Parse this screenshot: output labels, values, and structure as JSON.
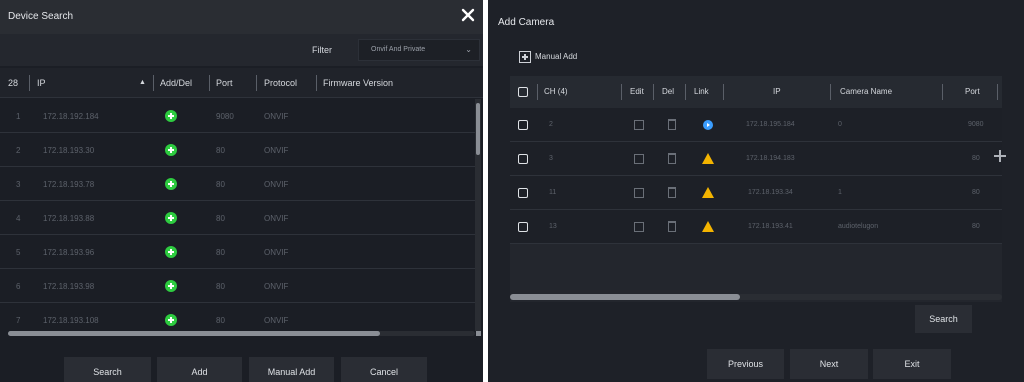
{
  "device_search": {
    "title": "Device Search",
    "filter_label": "Filter",
    "filter_value": "Onvif And Private",
    "count": "28",
    "columns": {
      "ip": "IP",
      "add_del": "Add/Del",
      "port": "Port",
      "protocol": "Protocol",
      "firmware": "Firmware Version"
    },
    "rows": [
      {
        "no": "1",
        "ip": "172.18.192.184",
        "port": "9080",
        "protocol": "ONVIF",
        "firmware": ""
      },
      {
        "no": "2",
        "ip": "172.18.193.30",
        "port": "80",
        "protocol": "ONVIF",
        "firmware": ""
      },
      {
        "no": "3",
        "ip": "172.18.193.78",
        "port": "80",
        "protocol": "ONVIF",
        "firmware": ""
      },
      {
        "no": "4",
        "ip": "172.18.193.88",
        "port": "80",
        "protocol": "ONVIF",
        "firmware": ""
      },
      {
        "no": "5",
        "ip": "172.18.193.96",
        "port": "80",
        "protocol": "ONVIF",
        "firmware": ""
      },
      {
        "no": "6",
        "ip": "172.18.193.98",
        "port": "80",
        "protocol": "ONVIF",
        "firmware": ""
      },
      {
        "no": "7",
        "ip": "172.18.193.108",
        "port": "80",
        "protocol": "ONVIF",
        "firmware": ""
      }
    ],
    "buttons": {
      "search": "Search",
      "add": "Add",
      "manual_add": "Manual Add",
      "cancel": "Cancel"
    }
  },
  "add_camera": {
    "title": "Add Camera",
    "manual_add": "Manual Add",
    "columns": {
      "ch": "CH (4)",
      "edit": "Edit",
      "del": "Del",
      "link": "Link",
      "ip": "IP",
      "camera_name": "Camera Name",
      "port": "Port"
    },
    "rows": [
      {
        "ch": "2",
        "link": "connected",
        "ip": "172.18.195.184",
        "camera_name": "0",
        "port": "9080"
      },
      {
        "ch": "3",
        "link": "warning",
        "ip": "172.18.194.183",
        "camera_name": "",
        "port": "80"
      },
      {
        "ch": "11",
        "link": "warning",
        "ip": "172.18.193.34",
        "camera_name": "1",
        "port": "80"
      },
      {
        "ch": "13",
        "link": "warning",
        "ip": "172.18.193.41",
        "camera_name": "audiotelugon",
        "port": "80"
      }
    ],
    "search_button": "Search",
    "buttons": {
      "previous": "Previous",
      "next": "Next",
      "exit": "Exit"
    }
  },
  "colors": {
    "add_green": "#2ecc40",
    "link_blue": "#3a9dff",
    "warning_yellow": "#f4b400",
    "panel_bg": "#1b1e25"
  }
}
